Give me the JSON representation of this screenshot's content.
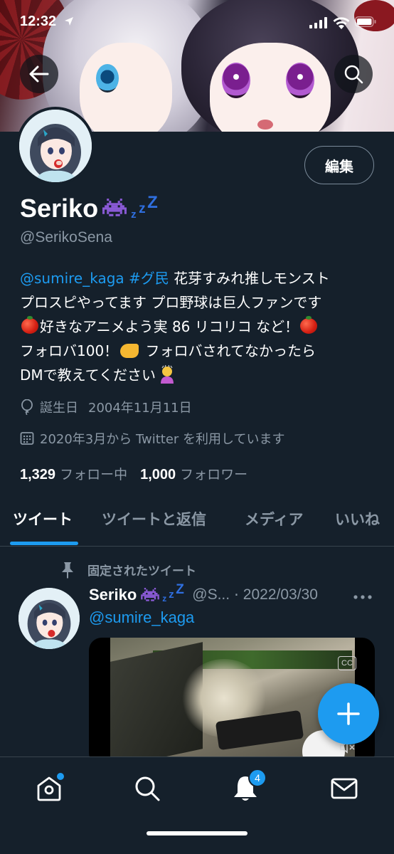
{
  "status_bar": {
    "time": "12:32"
  },
  "profile": {
    "display_name": "Seriko",
    "zzz": "zzZ",
    "handle": "@SerikoSena",
    "edit_label": "編集",
    "bio": {
      "mention": "@sumire_kaga",
      "hashtag": "#グ民",
      "line1_text": " 花芽すみれ推しモンスト",
      "line2": "プロスピやってます プロ野球は巨人ファンです",
      "line3_text": "好きなアニメよう実 86 リコリコ など！",
      "line4_a": "フォロバ100！",
      "line4_b": " フォロバされてなかったら",
      "line5": "DMで教えてください"
    },
    "birthday_label": "誕生日",
    "birthday": "2004年11月11日",
    "joined": "2020年3月から Twitter を利用しています",
    "following_count": "1,329",
    "following_label": "フォロー中",
    "followers_count": "1,000",
    "followers_label": "フォロワー"
  },
  "tabs": [
    {
      "label": "ツイート",
      "active": true
    },
    {
      "label": "ツイートと返信",
      "active": false
    },
    {
      "label": "メディア",
      "active": false
    },
    {
      "label": "いいね",
      "active": false
    }
  ],
  "pinned_tweet": {
    "pinned_label": "固定されたツイート",
    "author_name": "Seriko",
    "zzz": "zzZ",
    "author_handle": "@S...",
    "dot": "·",
    "date": "2022/03/30",
    "mention": "@sumire_kaga",
    "cc_label": "CC"
  },
  "bottom_nav": {
    "notification_count": "4"
  },
  "icons": {
    "back": "arrow-left-icon",
    "search": "search-icon",
    "balloon": "balloon-icon",
    "calendar": "calendar-icon",
    "pin": "pin-icon",
    "more": "more-horizontal-icon",
    "compose": "plus-icon",
    "home": "home-icon",
    "notifications": "bell-icon",
    "messages": "envelope-icon"
  },
  "colors": {
    "background": "#15202b",
    "accent": "#1d9bf0",
    "secondary_text": "#8b98a5",
    "divider": "#38444d"
  }
}
